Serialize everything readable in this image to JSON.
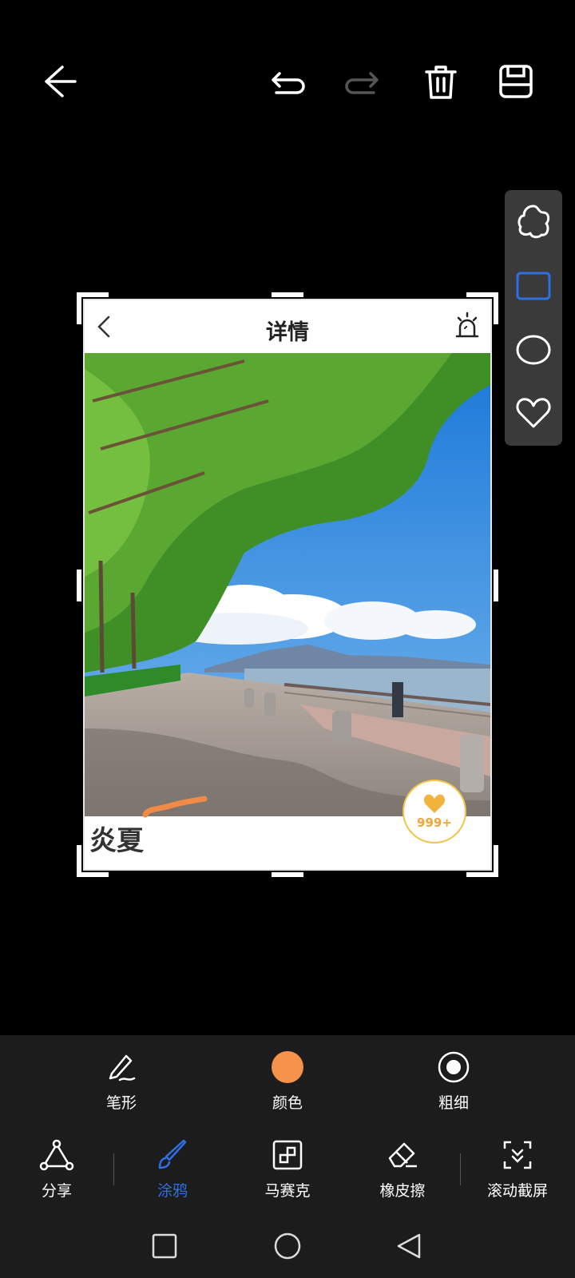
{
  "toolbar": {
    "back_icon": "arrow-left-icon",
    "undo_icon": "undo-icon",
    "redo_icon": "redo-icon",
    "delete_icon": "trash-icon",
    "save_icon": "save-icon"
  },
  "shapes": [
    "puzzle-icon",
    "rectangle-icon",
    "circle-icon",
    "heart-icon"
  ],
  "shape_selected": "rectangle",
  "detail": {
    "title": "详情",
    "caption": "炎夏",
    "like_count": "999+"
  },
  "pen_options": [
    {
      "label": "笔形",
      "icon": "pen-style-icon"
    },
    {
      "label": "颜色",
      "icon": "color-dot-icon"
    },
    {
      "label": "粗细",
      "icon": "thickness-icon"
    }
  ],
  "current_color": "#f5924c",
  "tools": [
    {
      "label": "分享",
      "icon": "share-icon"
    },
    {
      "label": "涂鸦",
      "icon": "brush-icon",
      "active": true
    },
    {
      "label": "马赛克",
      "icon": "mosaic-icon"
    },
    {
      "label": "橡皮擦",
      "icon": "eraser-icon"
    },
    {
      "label": "滚动截屏",
      "icon": "scroll-capture-icon"
    }
  ],
  "active_color": "#2f6fe6",
  "nav": [
    "recent-apps-icon",
    "home-icon",
    "back-triangle-icon"
  ]
}
